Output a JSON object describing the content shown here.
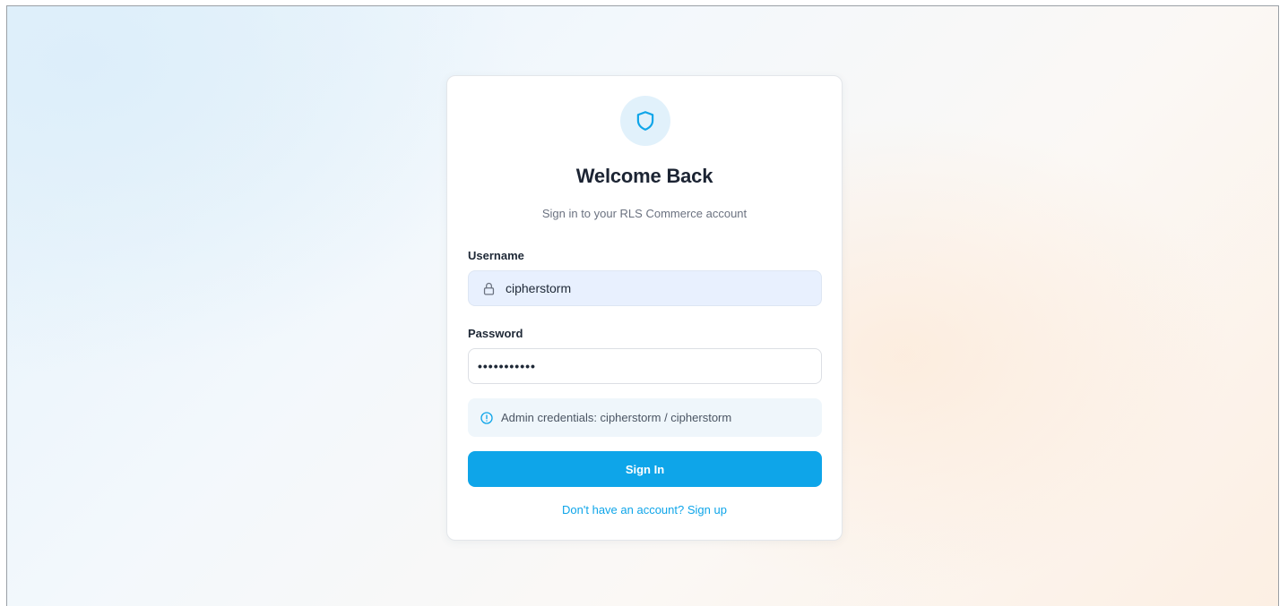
{
  "login": {
    "title": "Welcome Back",
    "subtitle": "Sign in to your RLS Commerce account",
    "username_label": "Username",
    "username_value": "cipherstorm",
    "password_label": "Password",
    "password_masked": "•••••••••••",
    "notice_text": "Admin credentials: cipherstorm / cipherstorm",
    "signin_label": "Sign In",
    "signup_link": "Don't have an account? Sign up"
  },
  "icons": {
    "logo": "shield-icon",
    "username_field": "lock-icon",
    "notice": "info-icon"
  },
  "colors": {
    "accent": "#0ea5e9",
    "logo_bg": "#e1f1fb",
    "username_field_bg": "#e8f0fe",
    "notice_bg": "#eff6fb"
  }
}
